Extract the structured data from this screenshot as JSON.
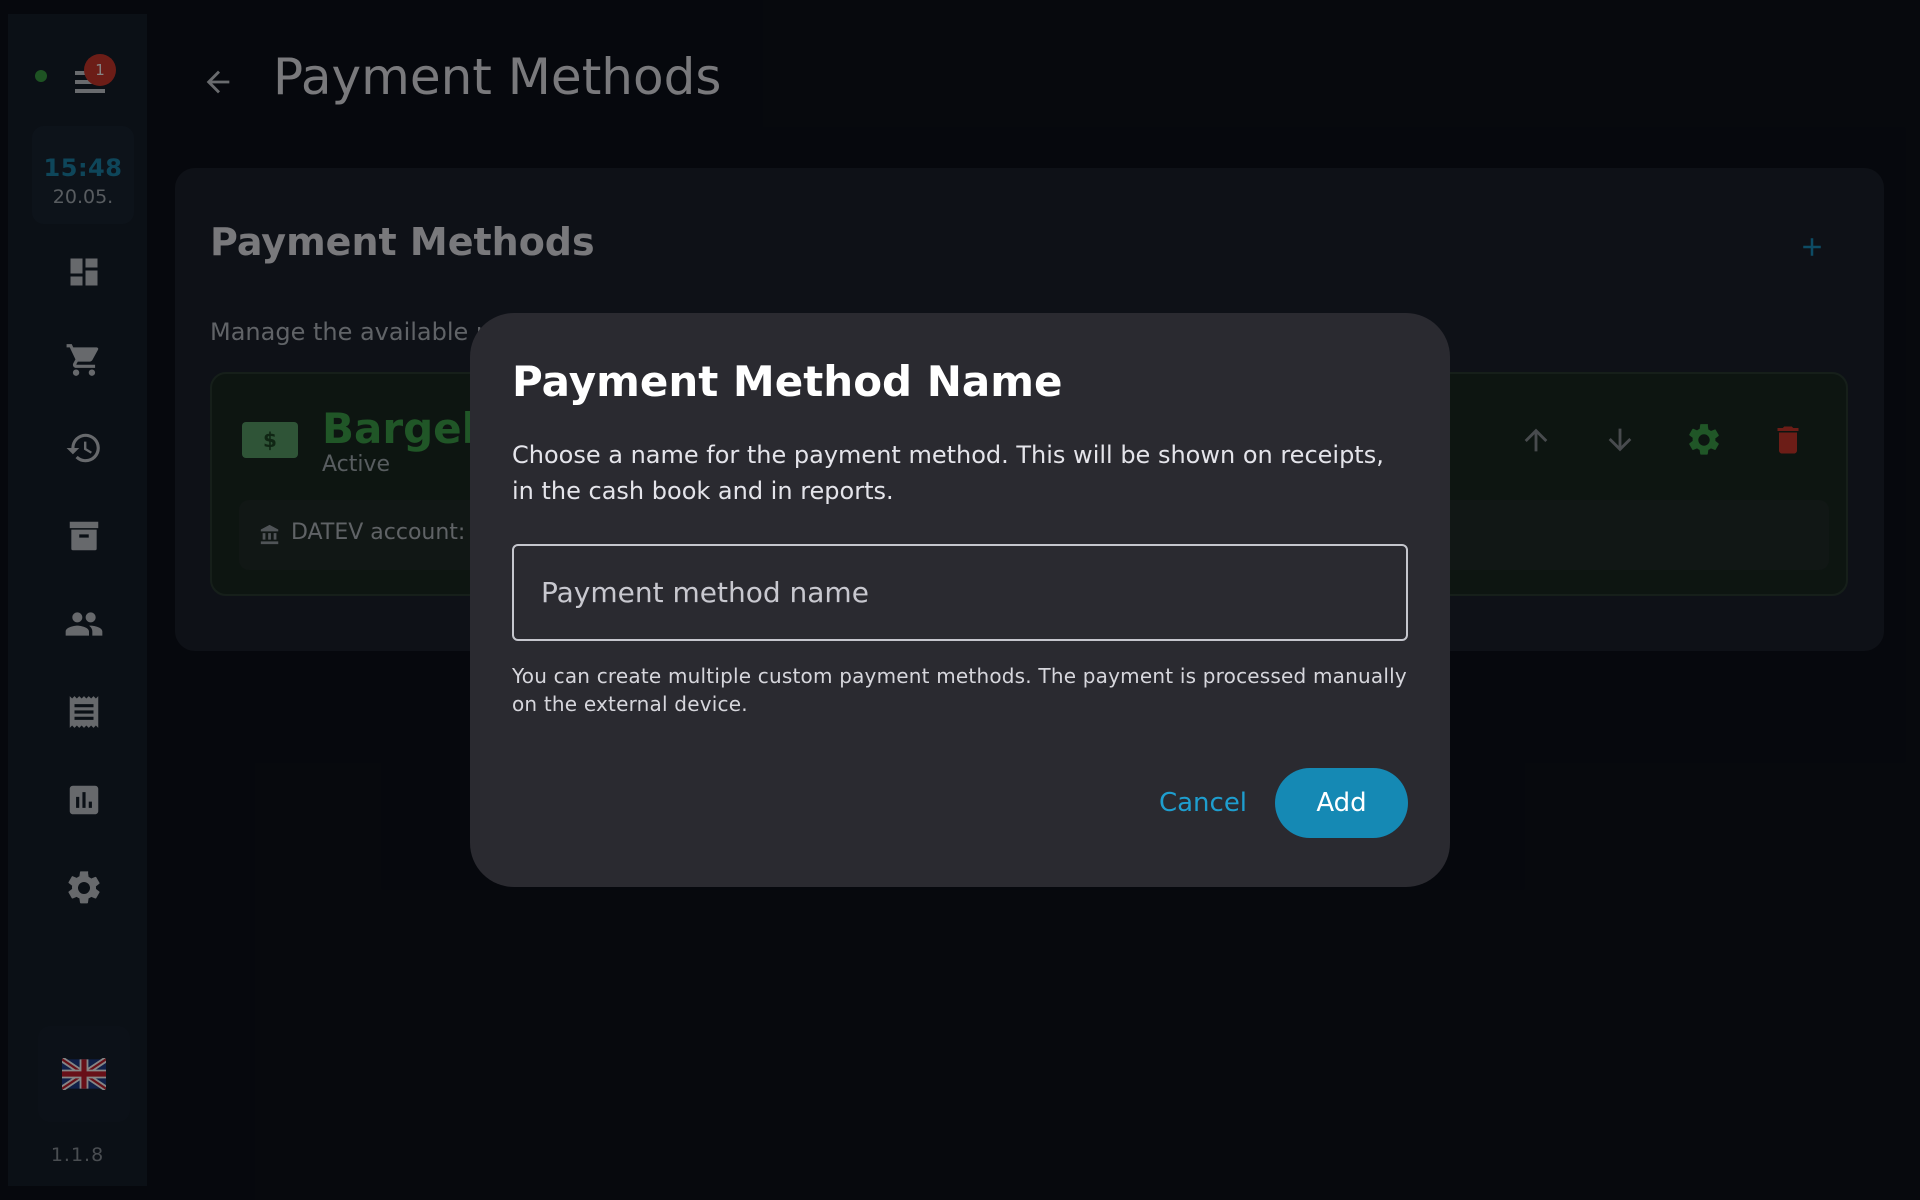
{
  "sidebar": {
    "notification_count": "1",
    "clock_time": "15:48",
    "clock_date": "20.05.",
    "nav_icons": [
      "dashboard-icon",
      "cart-icon",
      "history-icon",
      "archive-icon",
      "people-icon",
      "receipt-icon",
      "chart-icon",
      "settings-icon"
    ],
    "language_icon": "uk-flag-icon",
    "version": "1.1.8"
  },
  "header": {
    "title": "Payment Methods"
  },
  "card": {
    "title": "Payment Methods",
    "description": "Manage the available p",
    "method": {
      "icon": "money-icon",
      "icon_symbol": "$",
      "name": "Bargeld",
      "status": "Active",
      "datev_label": "DATEV account: 1"
    }
  },
  "dialog": {
    "title": "Payment Method Name",
    "description": "Choose a name for the payment method. This will be shown on receipts, in the cash book and in reports.",
    "input_placeholder": "Payment method name",
    "input_value": "",
    "helper_text": "You can create multiple custom payment methods. The payment is processed manually on the external device.",
    "cancel_label": "Cancel",
    "add_label": "Add"
  },
  "colors": {
    "background": "#0d1119",
    "accent": "#1589b4",
    "active_green": "#3ea64b",
    "danger": "#d0392c"
  }
}
